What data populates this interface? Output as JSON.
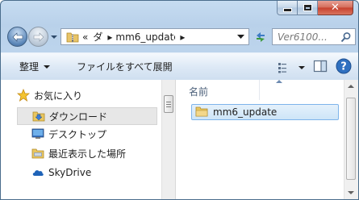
{
  "address": {
    "chevrons": "«",
    "crumb1": "ダ",
    "crumb2": "mm6_update",
    "separator": "▸"
  },
  "search": {
    "placeholder": "Ver6100..."
  },
  "toolbar": {
    "organize_label": "整理",
    "burn_label": "ファイルをすべて展開",
    "help_label": "?"
  },
  "navpane": {
    "items": [
      {
        "label": "お気に入り",
        "icon": "star-icon"
      },
      {
        "label": "ダウンロード",
        "icon": "downloads-folder-icon"
      },
      {
        "label": "デスクトップ",
        "icon": "desktop-icon"
      },
      {
        "label": "最近表示した場所",
        "icon": "recent-places-icon"
      },
      {
        "label": "SkyDrive",
        "icon": "skydrive-icon"
      }
    ]
  },
  "filepane": {
    "column_name": "名前",
    "files": [
      {
        "name": "mm6_update",
        "icon": "folder-icon"
      }
    ]
  },
  "colors": {
    "frame": "#b9d1ea",
    "selection": "#cde5f8",
    "close_button": "#c7402d"
  }
}
